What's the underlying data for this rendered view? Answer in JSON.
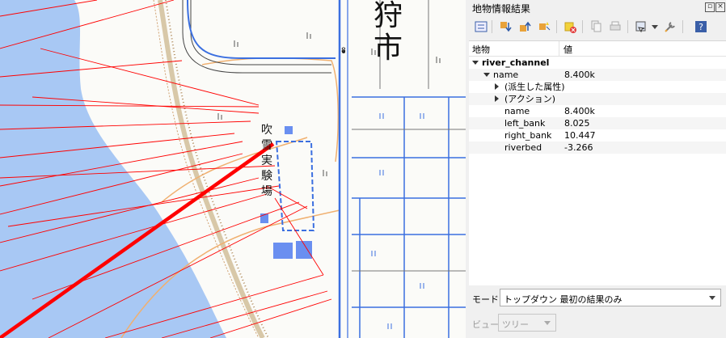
{
  "map": {
    "label_city": "狩\n市",
    "label_site": "吹雪実験場",
    "route_number": "8"
  },
  "panel": {
    "title": "地物情報結果",
    "columns": {
      "feature": "地物",
      "value": "値"
    },
    "rows": [
      {
        "name": "river_channel",
        "value": "",
        "level": 0,
        "expander": "down",
        "bold": true
      },
      {
        "name": "name",
        "value": "8.400k",
        "level": 1,
        "expander": "down",
        "bold": false
      },
      {
        "name": "(派生した属性)",
        "value": "",
        "level": 2,
        "expander": "right",
        "bold": false
      },
      {
        "name": "(アクション)",
        "value": "",
        "level": 2,
        "expander": "right",
        "bold": false
      },
      {
        "name": "name",
        "value": "8.400k",
        "level": 2,
        "expander": "",
        "bold": false
      },
      {
        "name": "left_bank",
        "value": "8.025",
        "level": 2,
        "expander": "",
        "bold": false
      },
      {
        "name": "right_bank",
        "value": "10.447",
        "level": 2,
        "expander": "",
        "bold": false
      },
      {
        "name": "riverbed",
        "value": "-3.266",
        "level": 2,
        "expander": "",
        "bold": false
      }
    ],
    "mode_label": "モード",
    "mode_value": "トップダウン 最初の結果のみ",
    "view_label": "ビュー",
    "view_value": "ツリー"
  },
  "colors": {
    "water": "#a8c8f4",
    "river_bank": "#ff0000",
    "road_blue": "#3b6fe0",
    "road_orange": "#f0b070"
  },
  "icons": [
    "expand-tree-icon",
    "select-next-icon",
    "select-previous-icon",
    "highlight-icon",
    "clear-results-icon",
    "copy-icon",
    "print-icon",
    "identify-options-icon",
    "settings-icon",
    "help-icon"
  ]
}
